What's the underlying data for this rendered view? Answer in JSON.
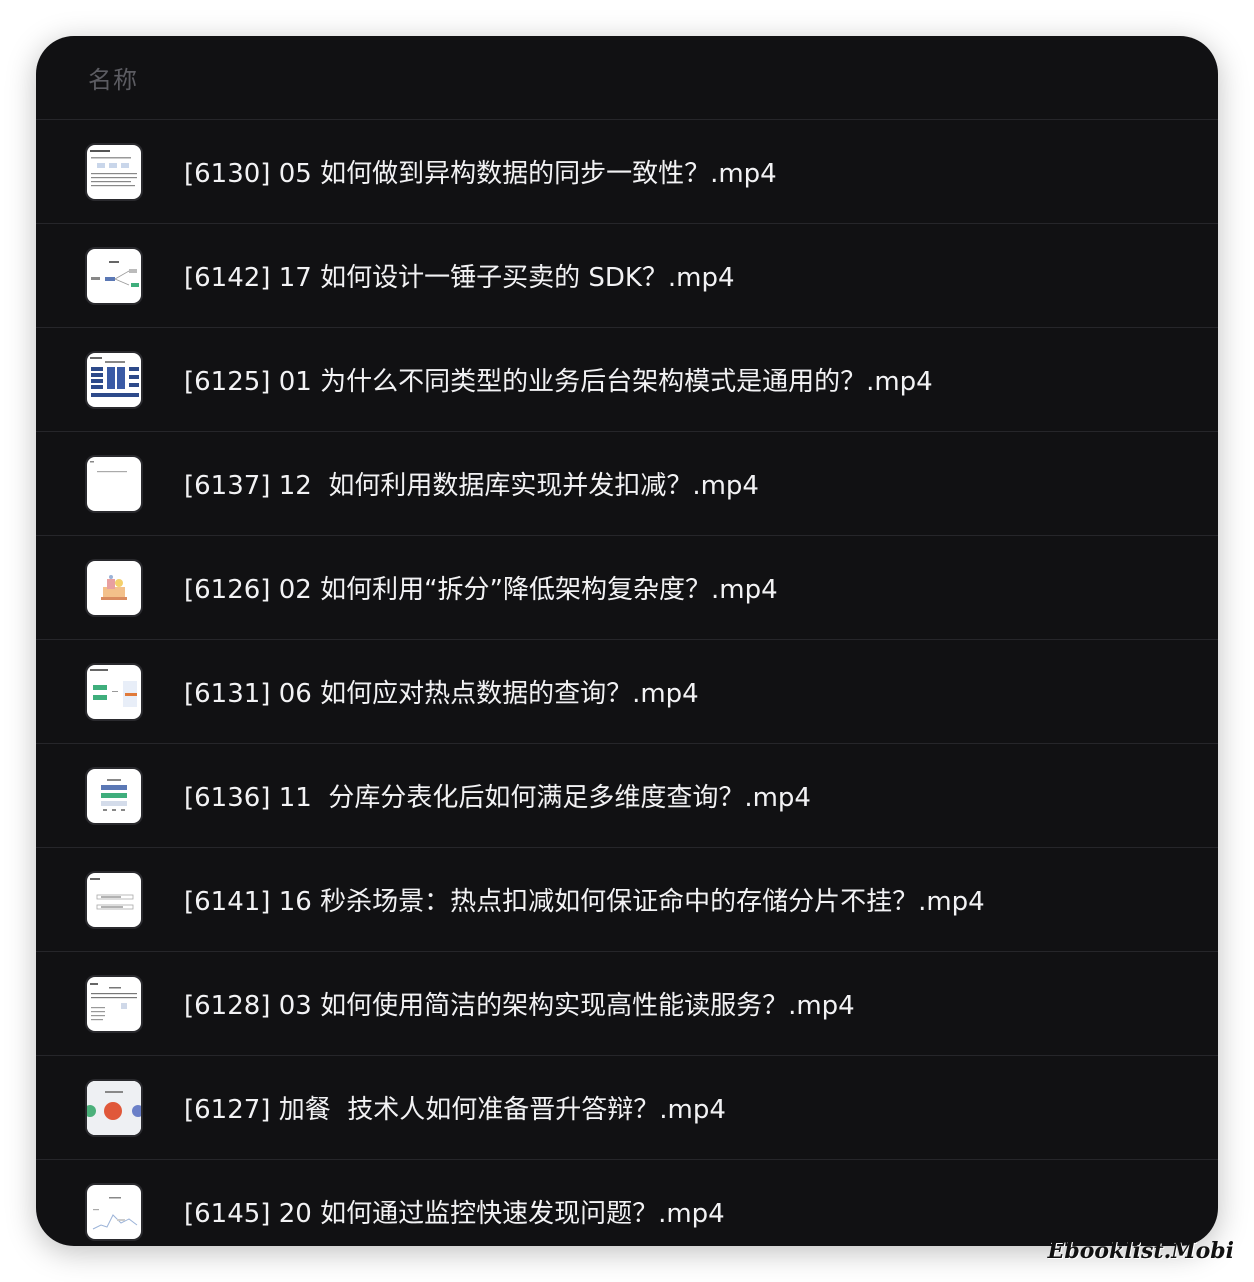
{
  "header": {
    "column_label": "名称"
  },
  "files": [
    {
      "name": "[6130] 05 如何做到异构数据的同步一致性？.mp4",
      "thumbnail": "video-thumbnail-diagram-text"
    },
    {
      "name": "[6142] 17 如何设计一锤子买卖的 SDK？.mp4",
      "thumbnail": "video-thumbnail-flow-diagram"
    },
    {
      "name": "[6125] 01 为什么不同类型的业务后台架构模式是通用的？.mp4",
      "thumbnail": "video-thumbnail-architecture-blocks"
    },
    {
      "name": "[6137] 12  如何利用数据库实现并发扣减？.mp4",
      "thumbnail": "video-thumbnail-blank"
    },
    {
      "name": "[6126] 02 如何利用“拆分”降低架构复杂度？.mp4",
      "thumbnail": "video-thumbnail-illustration"
    },
    {
      "name": "[6131] 06 如何应对热点数据的查询？.mp4",
      "thumbnail": "video-thumbnail-green-blocks"
    },
    {
      "name": "[6136] 11  分库分表化后如何满足多维度查询？.mp4",
      "thumbnail": "video-thumbnail-table-diagram"
    },
    {
      "name": "[6141] 16 秒杀场景：热点扣减如何保证命中的存储分片不挂？.mp4",
      "thumbnail": "video-thumbnail-list-diagram"
    },
    {
      "name": "[6128] 03 如何使用简洁的架构实现高性能读服务？.mp4",
      "thumbnail": "video-thumbnail-text-slide"
    },
    {
      "name": "[6127] 加餐  技术人如何准备晋升答辩？.mp4",
      "thumbnail": "video-thumbnail-circles"
    },
    {
      "name": "[6145] 20 如何通过监控快速发现问题？.mp4",
      "thumbnail": "video-thumbnail-chart"
    }
  ],
  "watermark": "Ebooklist.Mobi"
}
